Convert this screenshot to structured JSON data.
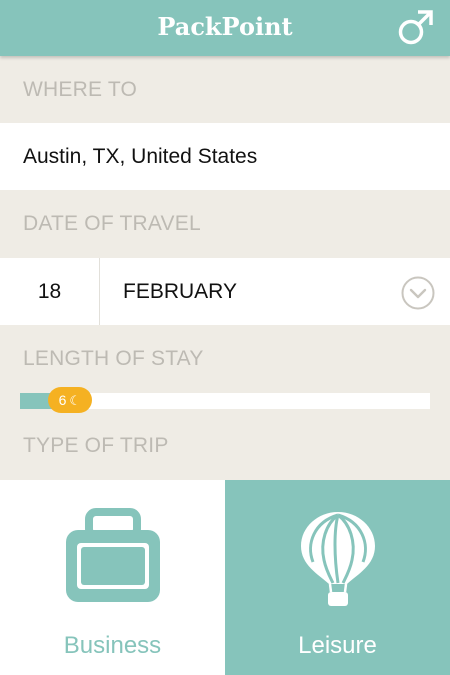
{
  "header": {
    "title": "PackPoint",
    "gender_icon": "male-symbol-icon"
  },
  "destination": {
    "label": "WHERE TO",
    "value": "Austin, TX, United States"
  },
  "date": {
    "label": "DATE OF TRAVEL",
    "day": "18",
    "month": "FEBRUARY",
    "dropdown_icon": "chevron-down-circle-icon"
  },
  "length": {
    "label": "LENGTH OF STAY",
    "nights": "6",
    "nights_icon": "moon-icon",
    "fill_fraction": 0.08
  },
  "trip": {
    "label": "TYPE OF TRIP",
    "options": [
      {
        "label": "Business",
        "icon": "briefcase-icon",
        "selected": false
      },
      {
        "label": "Leisure",
        "icon": "hot-air-balloon-icon",
        "selected": true
      }
    ]
  },
  "colors": {
    "accent": "#86c4bb",
    "background": "#efece5",
    "label": "#bdbab3",
    "badge": "#f5b122"
  }
}
